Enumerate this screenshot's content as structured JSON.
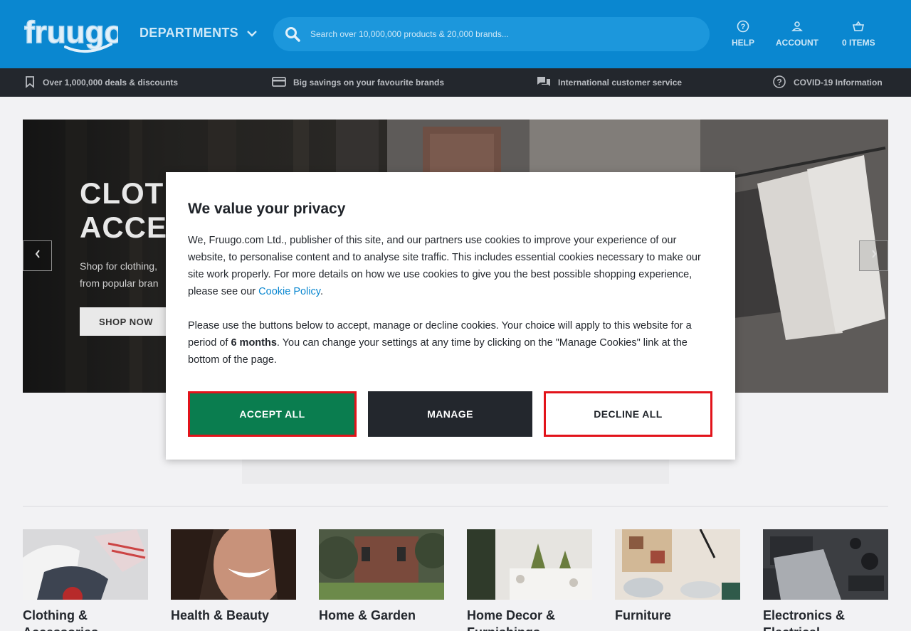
{
  "header": {
    "logo_text": "fruugo",
    "departments_label": "DEPARTMENTS",
    "search": {
      "placeholder": "Search over 10,000,000 products & 20,000 brands..."
    },
    "help_label": "HELP",
    "account_label": "ACCOUNT",
    "cart_label": "0 ITEMS"
  },
  "usp_bar": {
    "items": [
      {
        "icon": "bookmark-icon",
        "label": "Over 1,000,000 deals & discounts"
      },
      {
        "icon": "credit-card-icon",
        "label": "Big savings on your favourite brands"
      },
      {
        "icon": "chat-icon",
        "label": "International customer service"
      },
      {
        "icon": "help-circle-icon",
        "label": "COVID-19 Information"
      }
    ]
  },
  "hero": {
    "title_line1": "CLOTH",
    "title_line2": "ACCES",
    "subtitle_line1": "Shop for clothing,",
    "subtitle_line2": "from popular bran",
    "cta_label": "SHOP NOW"
  },
  "categories": [
    {
      "label_line1": "Clothing &",
      "label_line2": "Accessories"
    },
    {
      "label_line1": "Health & Beauty",
      "label_line2": ""
    },
    {
      "label_line1": "Home & Garden",
      "label_line2": ""
    },
    {
      "label_line1": "Home Decor &",
      "label_line2": "Furnishings"
    },
    {
      "label_line1": "Furniture",
      "label_line2": ""
    },
    {
      "label_line1": "Electronics &",
      "label_line2": "Electrical"
    }
  ],
  "privacy_modal": {
    "title": "We value your privacy",
    "para1_text": "We, Fruugo.com Ltd., publisher of this site, and our partners use cookies to improve your experience of our website, to personalise content and to analyse site traffic. This includes essential cookies necessary to make our site work properly. For more details on how we use cookies to give you the best possible shopping experience, please see our ",
    "cookie_policy_link": "Cookie Policy",
    "para1_end": ".",
    "para2_start": "Please use the buttons below to accept, manage or decline cookies. Your choice will apply to this website for a period of ",
    "para2_bold": "6 months",
    "para2_end": ". You can change your settings at any time by clicking on the \"Manage Cookies\" link at the bottom of the page.",
    "accept_label": "ACCEPT ALL",
    "manage_label": "MANAGE",
    "decline_label": "DECLINE ALL"
  },
  "colors": {
    "header_blue": "#0a87d0",
    "usp_bar": "#23272d",
    "accept_green": "#0a7d4f",
    "highlight_red": "#e2131a"
  }
}
